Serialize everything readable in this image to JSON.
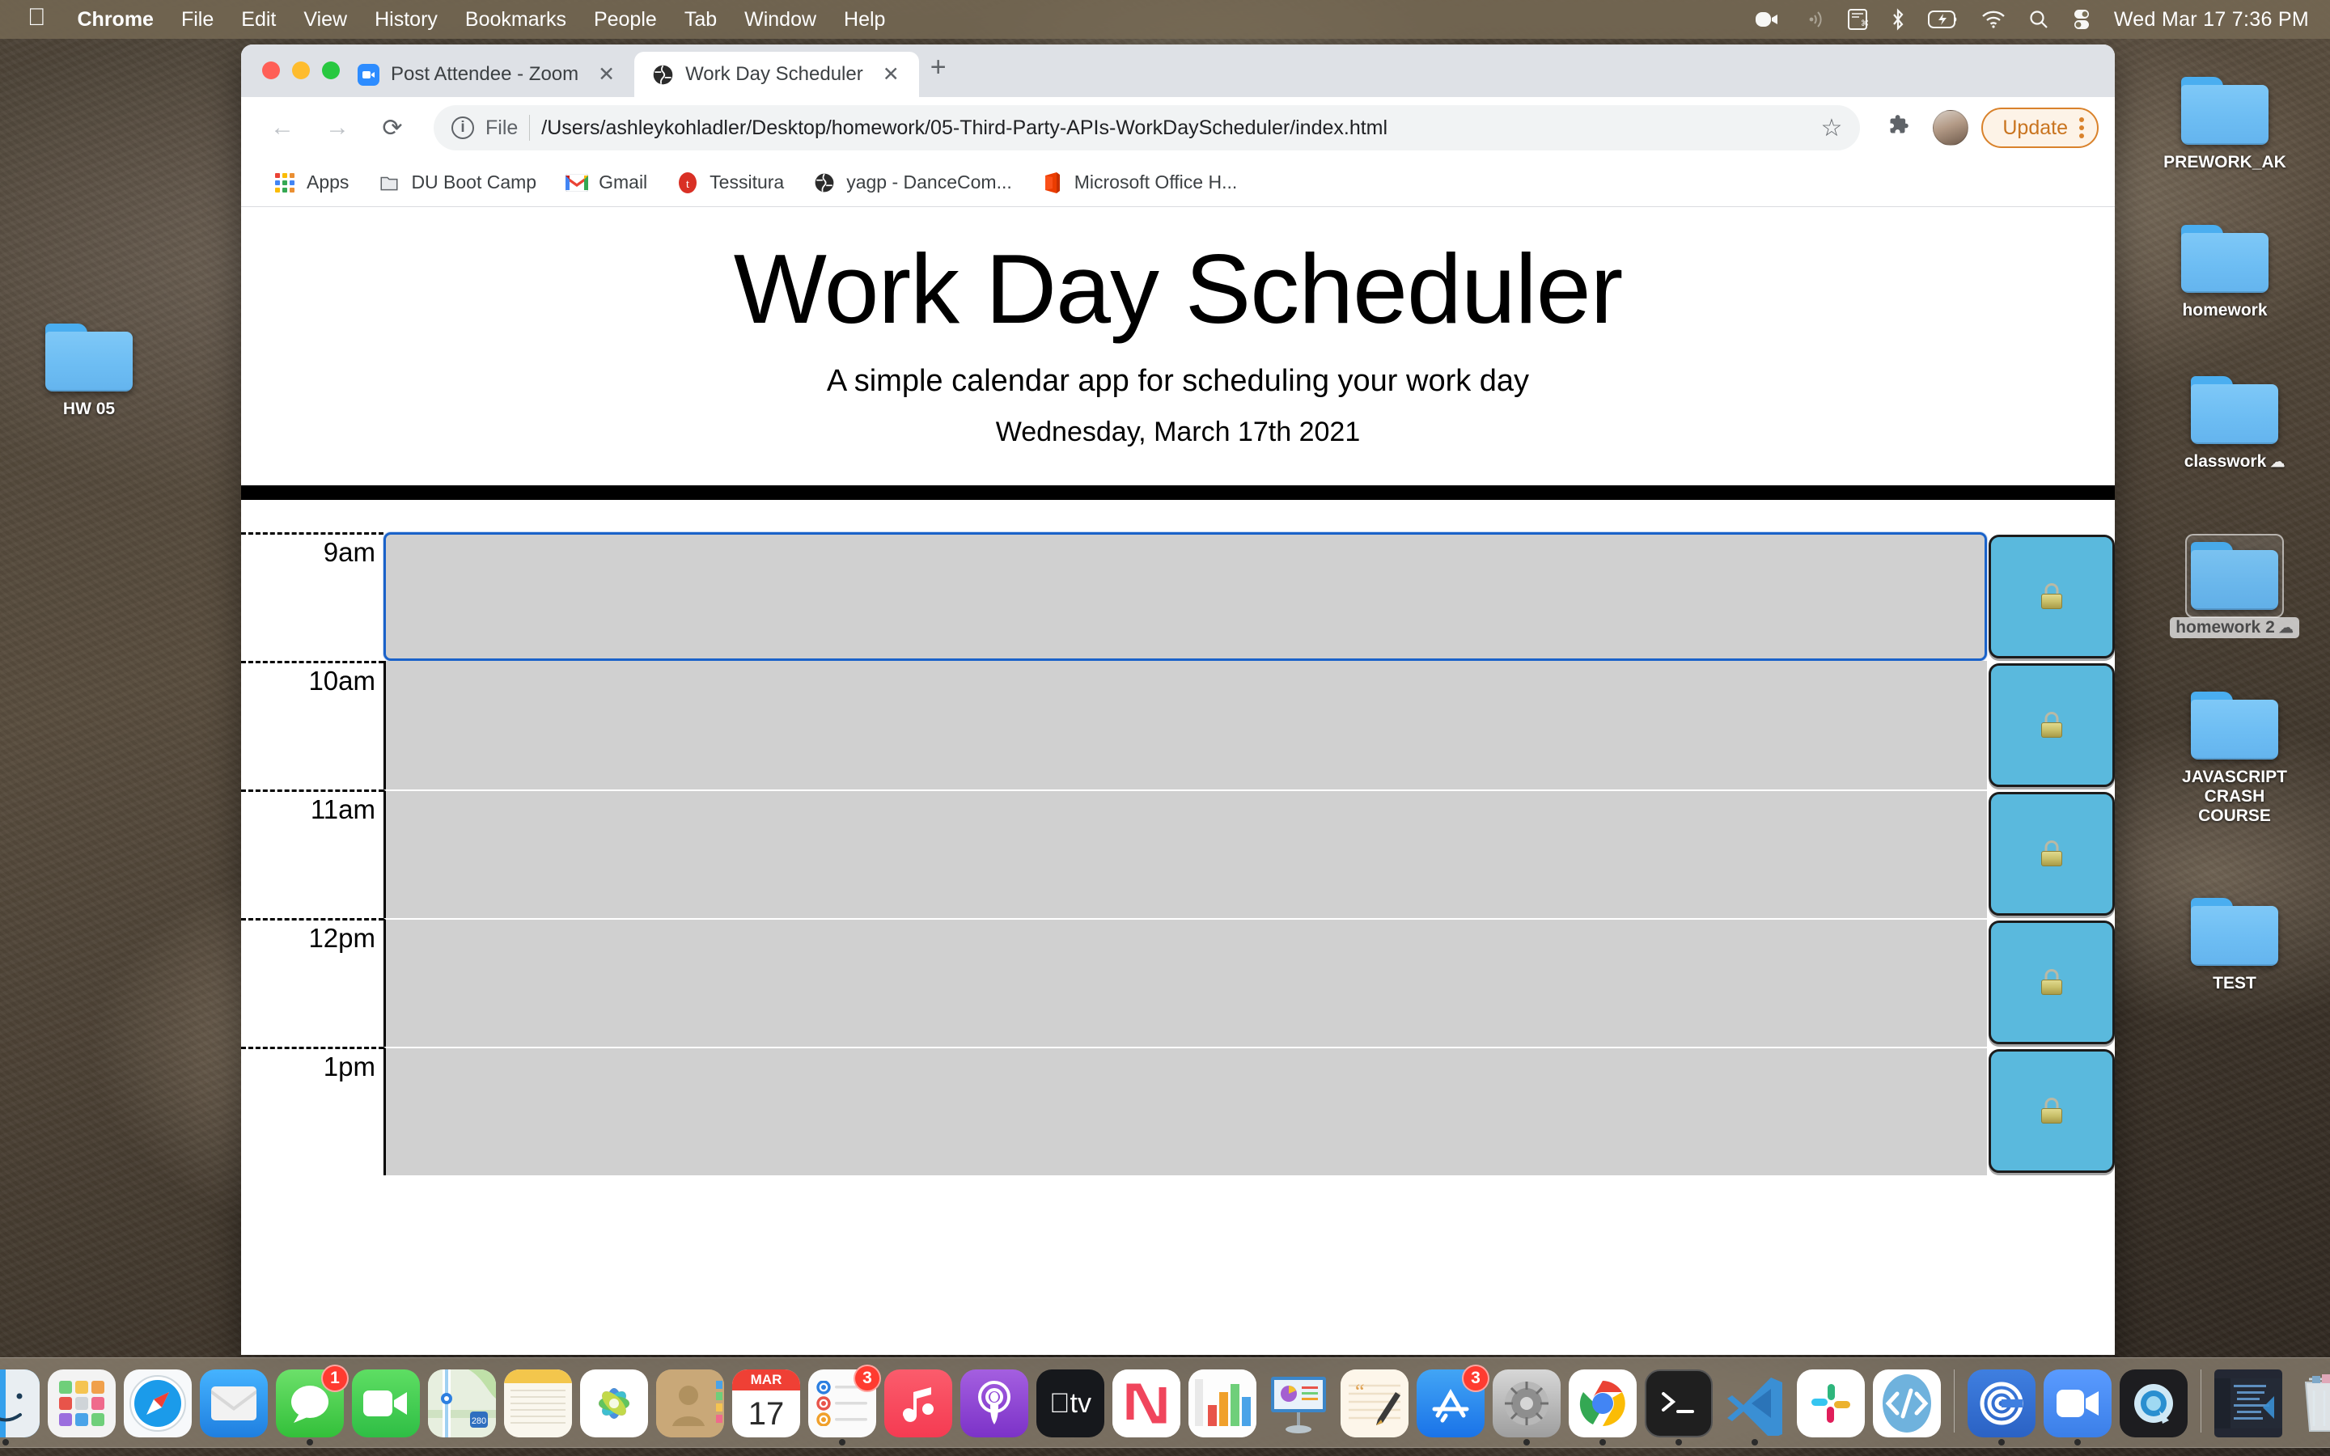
{
  "menubar": {
    "apple": "apple-logo",
    "items": [
      {
        "label": "Chrome",
        "bold": true
      },
      {
        "label": "File",
        "bold": false
      },
      {
        "label": "Edit",
        "bold": false
      },
      {
        "label": "View",
        "bold": false
      },
      {
        "label": "History",
        "bold": false
      },
      {
        "label": "Bookmarks",
        "bold": false
      },
      {
        "label": "People",
        "bold": false
      },
      {
        "label": "Tab",
        "bold": false
      },
      {
        "label": "Window",
        "bold": false
      },
      {
        "label": "Help",
        "bold": false
      }
    ],
    "status_icons": [
      "zoom-camera-icon",
      "airdrop-icon",
      "screenshot-icon",
      "bluetooth-icon",
      "battery-charging-icon",
      "wifi-icon",
      "spotlight-search-icon",
      "control-center-icon"
    ],
    "clock": "Wed Mar 17  7:36 PM"
  },
  "desktop": {
    "icons": [
      {
        "name": "HW 05",
        "selected": false,
        "cloud": false
      },
      {
        "name": "PREWORK_AK",
        "selected": false,
        "cloud": false
      },
      {
        "name": "homework",
        "selected": false,
        "cloud": false
      },
      {
        "name": "classwork",
        "selected": false,
        "cloud": true
      },
      {
        "name": "homework 2",
        "selected": true,
        "cloud": true
      },
      {
        "name": "JAVASCRIPT CRASH COURSE",
        "selected": false,
        "cloud": false
      },
      {
        "name": "TEST",
        "selected": false,
        "cloud": false
      }
    ]
  },
  "browser": {
    "tabs": [
      {
        "title": "Post Attendee - Zoom",
        "favicon": "zoom-icon",
        "active": false,
        "close": "✕"
      },
      {
        "title": "Work Day Scheduler",
        "favicon": "globe-icon",
        "active": true,
        "close": "✕"
      }
    ],
    "new_tab_label": "+",
    "nav": {
      "back": "←",
      "forward": "→",
      "reload": "⟳"
    },
    "omnibox": {
      "info_icon": "i",
      "scheme_label": "File",
      "url": "/Users/ashleykohladler/Desktop/homework/05-Third-Party-APIs-WorkDayScheduler/index.html",
      "star": "☆"
    },
    "extensions_icon": "puzzle-piece-icon",
    "profile_icon": "avatar",
    "update_button": "Update",
    "bookmarks": [
      {
        "label": "Apps",
        "icon": "apps-grid-icon"
      },
      {
        "label": "DU Boot Camp",
        "icon": "folder-icon"
      },
      {
        "label": "Gmail",
        "icon": "gmail-icon"
      },
      {
        "label": "Tessitura",
        "icon": "tessitura-icon"
      },
      {
        "label": "yagp - DanceCom...",
        "icon": "globe-icon"
      },
      {
        "label": "Microsoft Office H...",
        "icon": "office-icon"
      }
    ]
  },
  "page": {
    "title": "Work Day Scheduler",
    "subtitle": "A simple calendar app for scheduling your work day",
    "today": "Wednesday, March 17th 2021",
    "rows": [
      {
        "hour": "9am",
        "text": "",
        "focused": true,
        "save_icon": "lock-icon"
      },
      {
        "hour": "10am",
        "text": "",
        "focused": false,
        "save_icon": "lock-icon"
      },
      {
        "hour": "11am",
        "text": "",
        "focused": false,
        "save_icon": "lock-icon"
      },
      {
        "hour": "12pm",
        "text": "",
        "focused": false,
        "save_icon": "lock-icon"
      },
      {
        "hour": "1pm",
        "text": "",
        "focused": false,
        "save_icon": "lock-icon"
      }
    ]
  },
  "dock": {
    "apps": [
      {
        "name": "finder",
        "running": true,
        "badge": null
      },
      {
        "name": "launchpad",
        "running": false,
        "badge": null
      },
      {
        "name": "safari",
        "running": false,
        "badge": null
      },
      {
        "name": "mail",
        "running": false,
        "badge": null
      },
      {
        "name": "messages",
        "running": true,
        "badge": "1"
      },
      {
        "name": "facetime",
        "running": false,
        "badge": null
      },
      {
        "name": "maps",
        "running": false,
        "badge": null
      },
      {
        "name": "notes",
        "running": false,
        "badge": null
      },
      {
        "name": "photos",
        "running": false,
        "badge": null
      },
      {
        "name": "contacts",
        "running": false,
        "badge": null
      },
      {
        "name": "calendar",
        "running": false,
        "badge": null,
        "month": "MAR",
        "day": "17"
      },
      {
        "name": "reminders",
        "running": true,
        "badge": "3"
      },
      {
        "name": "music",
        "running": false,
        "badge": null
      },
      {
        "name": "podcasts",
        "running": false,
        "badge": null
      },
      {
        "name": "apple-tv",
        "running": false,
        "badge": null
      },
      {
        "name": "news",
        "running": false,
        "badge": null
      },
      {
        "name": "numbers",
        "running": false,
        "badge": null
      },
      {
        "name": "keynote",
        "running": false,
        "badge": null
      },
      {
        "name": "pages",
        "running": false,
        "badge": null
      },
      {
        "name": "app-store",
        "running": false,
        "badge": "3"
      },
      {
        "name": "system-preferences",
        "running": true,
        "badge": null
      },
      {
        "name": "chrome",
        "running": true,
        "badge": null
      },
      {
        "name": "terminal",
        "running": true,
        "badge": null
      },
      {
        "name": "visual-studio-code",
        "running": true,
        "badge": null
      },
      {
        "name": "slack",
        "running": false,
        "badge": null
      },
      {
        "name": "code-editor",
        "running": false,
        "badge": null
      },
      {
        "name": "airdrop-app",
        "running": true,
        "badge": null
      },
      {
        "name": "zoom",
        "running": true,
        "badge": null
      },
      {
        "name": "quicktime",
        "running": false,
        "badge": null
      }
    ],
    "minimized": [
      {
        "name": "vscode-window-preview"
      }
    ],
    "trash": {
      "name": "trash",
      "full": true
    }
  }
}
